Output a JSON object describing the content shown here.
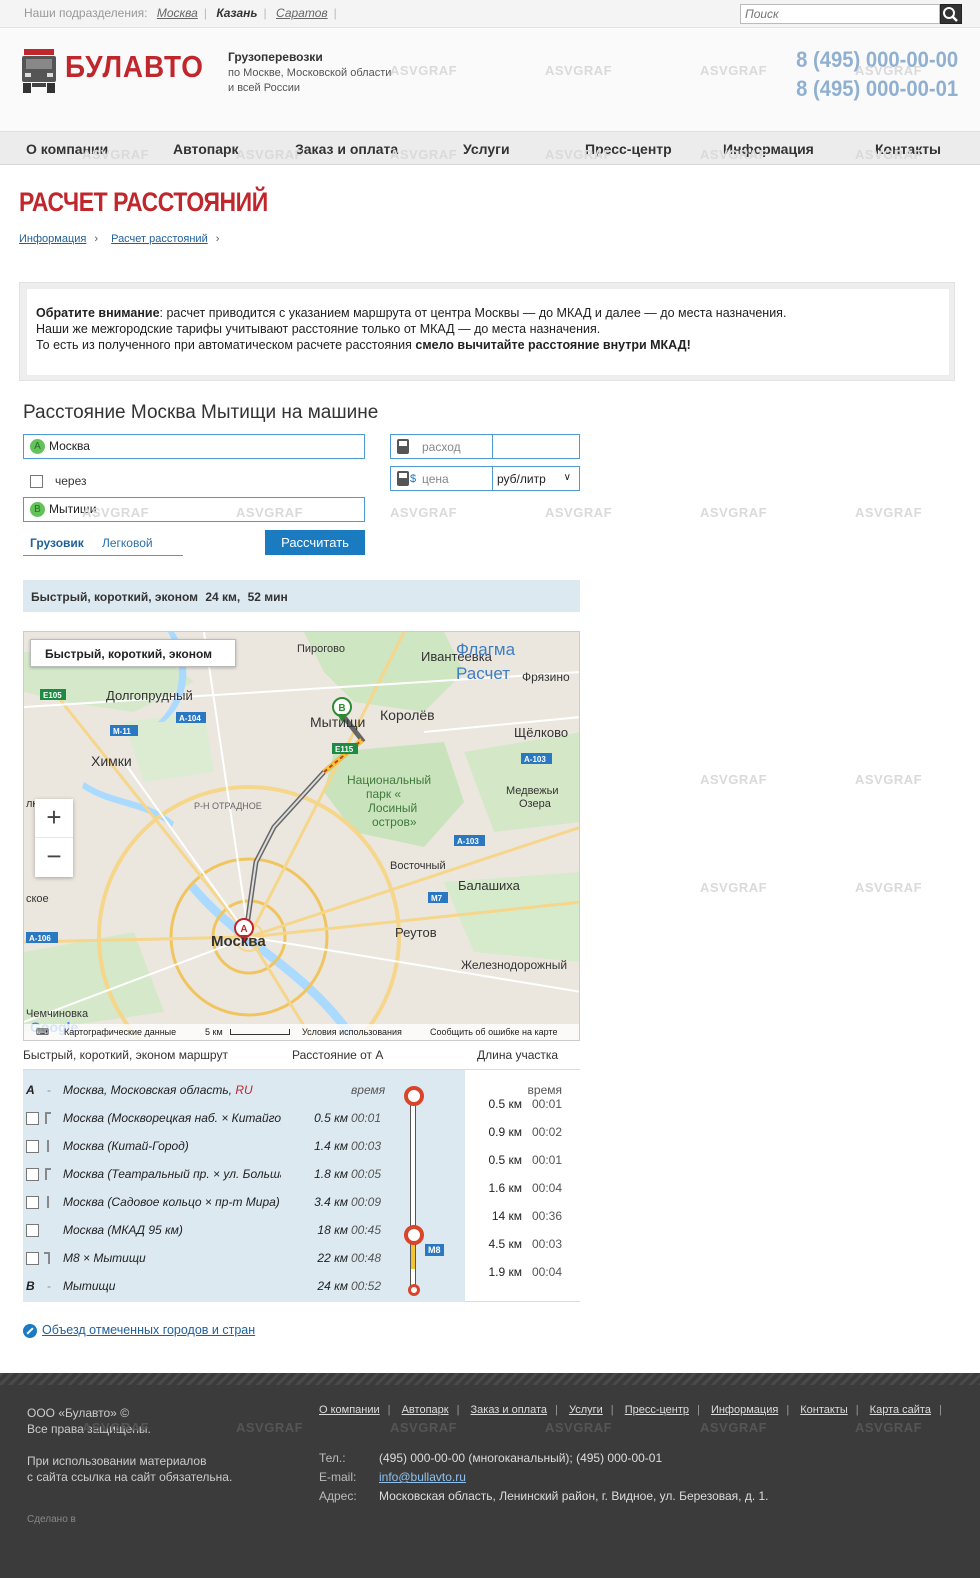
{
  "topbar": {
    "divisions_label": "Наши подразделения:",
    "divisions": [
      "Москва",
      "Казань",
      "Саратов"
    ],
    "active_division": "Казань",
    "search_placeholder": "Поиск"
  },
  "header": {
    "logo_text": "БУЛАВТО",
    "tagline_title": "Грузоперевозки",
    "tagline_line2": "по Москве, Московской области",
    "tagline_line3": "и всей России",
    "phone1": "8 (495) 000-00-00",
    "phone2": "8 (495) 000-00-01",
    "watermark": "ASVGRAF"
  },
  "nav": {
    "items": [
      "О компании",
      "Автопарк",
      "Заказ и оплата",
      "Услуги",
      "Пресс-центр",
      "Информация",
      "Контакты"
    ]
  },
  "page": {
    "title": "РАСЧЕТ РАССТОЯНИЙ",
    "breadcrumbs": [
      "Информация",
      "Расчет расстояний"
    ]
  },
  "notice": {
    "bold1": "Обратите внимание",
    "text1": ": расчет приводится с указанием маршрута от центра Москвы — до МКАД и далее — до места назначения.",
    "line2": "Наши же межгородские тарифы учитывают расстояние только от МКАД  — до места назначения.",
    "line3": "То есть из полученного при автоматическом расчете расстояния ",
    "bold3": "смело вычитайте расстояние внутри МКАД!"
  },
  "calc": {
    "title": "Расстояние Москва Мытищи на машине",
    "from_mark": "A",
    "from_value": "Москва",
    "via_label": "через",
    "to_mark": "B",
    "to_value": "Мытищи",
    "consumption_label": "расход",
    "price_label": "цена",
    "price_unit": "руб/литр",
    "tab_truck": "Грузовик",
    "tab_car": "Легковой",
    "button": "Рассчитать",
    "summary_type": "Быстрый, короткий, эконом",
    "summary_distance": "24 км,",
    "summary_time": "52 мин"
  },
  "map": {
    "route_label": "Быстрый, короткий, эконом",
    "flagma_line1": "Флагма",
    "flagma_line2": "Расчет",
    "places": {
      "pirogovo": "Пирогово",
      "ivanteevka": "Ивантеевка",
      "fryazino": "Фрязино",
      "dolgoprudny": "Долгопрудный",
      "mytishchi": "Мытищи",
      "korolev": "Королёв",
      "shchelkovo": "Щёлково",
      "khimki": "Химки",
      "park": "Национальный парк « Лосиный остров»",
      "park_l1": "Национальный",
      "park_l2": "парк «",
      "park_l3": "Лосиный",
      "park_l4": "остров»",
      "otradnoe": "Р-Н ОТРАДНОЕ",
      "medvezhi": "Медвежьи Озера",
      "medvezhi_l1": "Медвежьи",
      "medvezhi_l2": "Озера",
      "vostochny": "Восточный",
      "balashikha": "Балашиха",
      "moscow": "Москва",
      "reutov": "Реутов",
      "zheleznodorozhny": "Железнодорожный",
      "lkovo": "лково",
      "oskoe": "ское",
      "chemchenovka": "Чемчиновка"
    },
    "shields": [
      "E105",
      "A-104",
      "M-11",
      "E115",
      "A-103",
      "A-103",
      "M7",
      "A-106"
    ],
    "footer_data": "Картографические данные",
    "footer_scale": "5 км",
    "footer_terms": "Условия использования",
    "footer_report": "Сообщить об ошибке на карте",
    "zoom_in": "+",
    "zoom_out": "−",
    "google": "Google"
  },
  "route_table": {
    "col1": "Быстрый, короткий, эконом маршрут",
    "col2": "Расстояние от А",
    "col3": "Длина участка",
    "rows": [
      {
        "mark": "A",
        "name": "Москва, Московская область, ",
        "country": "RU",
        "dist": "",
        "time": "время"
      },
      {
        "mark": "",
        "name": "Москва (Москворецкая наб. × Китайгород",
        "dist": "0.5 км",
        "time": "00:01"
      },
      {
        "mark": "",
        "name": "Москва (Китай-Город)",
        "dist": "1.4 км",
        "time": "00:03"
      },
      {
        "mark": "",
        "name": "Москва (Театральный пр. × ул. Большая",
        "dist": "1.8 км",
        "time": "00:05"
      },
      {
        "mark": "",
        "name": "Москва (Садовое кольцо × пр-т Мира)",
        "dist": "3.4 км",
        "time": "00:09"
      },
      {
        "mark": "",
        "name": "Москва (МКАД 95 км)",
        "dist": "18 км",
        "time": "00:45"
      },
      {
        "mark": "",
        "name": "М8 × Мытищи",
        "dist": "22 км",
        "time": "00:48"
      },
      {
        "mark": "B",
        "name": "Мытищи",
        "dist": "24 км",
        "time": "00:52"
      }
    ],
    "legs": [
      {
        "dist": "",
        "time": "время"
      },
      {
        "dist": "0.5 км",
        "time": "00:01"
      },
      {
        "dist": "0.9 км",
        "time": "00:02"
      },
      {
        "dist": "0.5 км",
        "time": "00:01"
      },
      {
        "dist": "1.6 км",
        "time": "00:04"
      },
      {
        "dist": "14 км",
        "time": "00:36"
      },
      {
        "dist": "4.5 км",
        "time": "00:03"
      },
      {
        "dist": "1.9 км",
        "time": "00:04"
      }
    ],
    "badge": "M8",
    "avoid_link": "Объезд отмеченных городов и стран"
  },
  "footer": {
    "copy_line1": "ООО «Булавто» ©",
    "copy_line2": "Все права защищены.",
    "note_line1": "При использовании материалов",
    "note_line2": "с сайта ссылка на сайт обязательна.",
    "made": "Сделано в",
    "links": [
      "О компании",
      "Автопарк",
      "Заказ и оплата",
      "Услуги",
      "Пресс-центр",
      "Информация",
      "Контакты",
      "Карта сайта"
    ],
    "tel_label": "Тел.:",
    "tel": "(495) 000-00-00 (многоканальный); (495) 000-00-01",
    "email_label": "E-mail:",
    "email": "info@bullavto.ru",
    "address_label": "Адрес:",
    "address": "Московская область, Ленинский район, г. Видное, ул. Березовая, д. 1."
  },
  "colors": {
    "brand_red": "#c0272d",
    "link_blue": "#1f5f9a",
    "button_blue": "#1a7bc1",
    "phone_blue": "#8fb0d1",
    "summary_bg": "#dde9f1",
    "footer_bg": "#3b3b3b"
  }
}
